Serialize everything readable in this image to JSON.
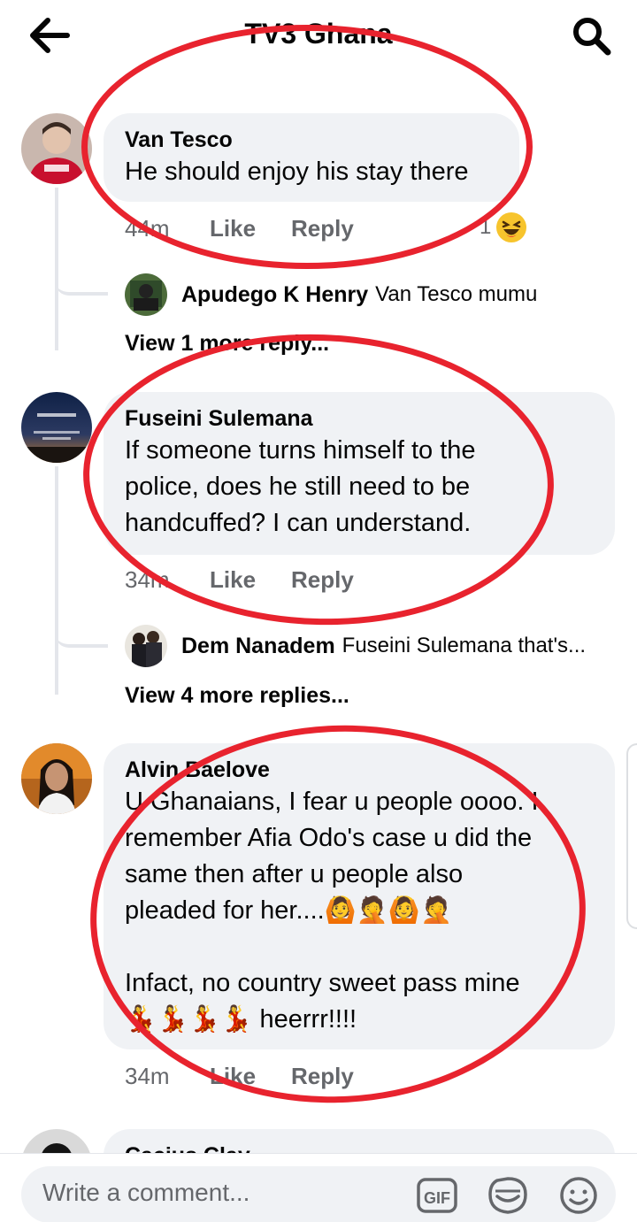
{
  "header": {
    "title": "TV3 Ghana"
  },
  "comments": [
    {
      "author": "Van Tesco",
      "lines": [
        "He should enjoy his stay there"
      ],
      "time": "44m",
      "like": "Like",
      "reply": "Reply",
      "reaction_count": "1",
      "replies_preview": {
        "author": "Apudego K Henry",
        "text": "Van Tesco mumu"
      },
      "view_more": "View 1 more reply..."
    },
    {
      "author": "Fuseini Sulemana",
      "lines": [
        "If someone turns himself to the",
        "police, does he still need to be",
        "handcuffed? I can understand."
      ],
      "time": "34m",
      "like": "Like",
      "reply": "Reply",
      "replies_preview": {
        "author": "Dem Nanadem",
        "text": "Fuseini Sulemana that's..."
      },
      "view_more": "View 4 more replies..."
    },
    {
      "author": "Alvin Baelove",
      "lines": [
        "U Ghanaians, I fear u people oooo. I",
        "remember Afia Odo's case u did the",
        "same then after u people also",
        "pleaded for her....🙆🤦🙆🤦",
        "",
        "Infact, no country sweet pass mine",
        "💃💃💃💃 heerrr!!!!"
      ],
      "time": "34m",
      "like": "Like",
      "reply": "Reply"
    },
    {
      "author": "Cacius Clay"
    }
  ],
  "composer": {
    "placeholder": "Write a comment...",
    "gif_label": "GIF"
  },
  "colors": {
    "highlight": "#e8232e",
    "bubble": "#f0f2f5",
    "meta": "#65676b"
  },
  "icons": [
    "back-arrow-icon",
    "search-icon",
    "gif-icon",
    "sticker-icon",
    "emoji-icon",
    "laugh-reaction-icon"
  ]
}
